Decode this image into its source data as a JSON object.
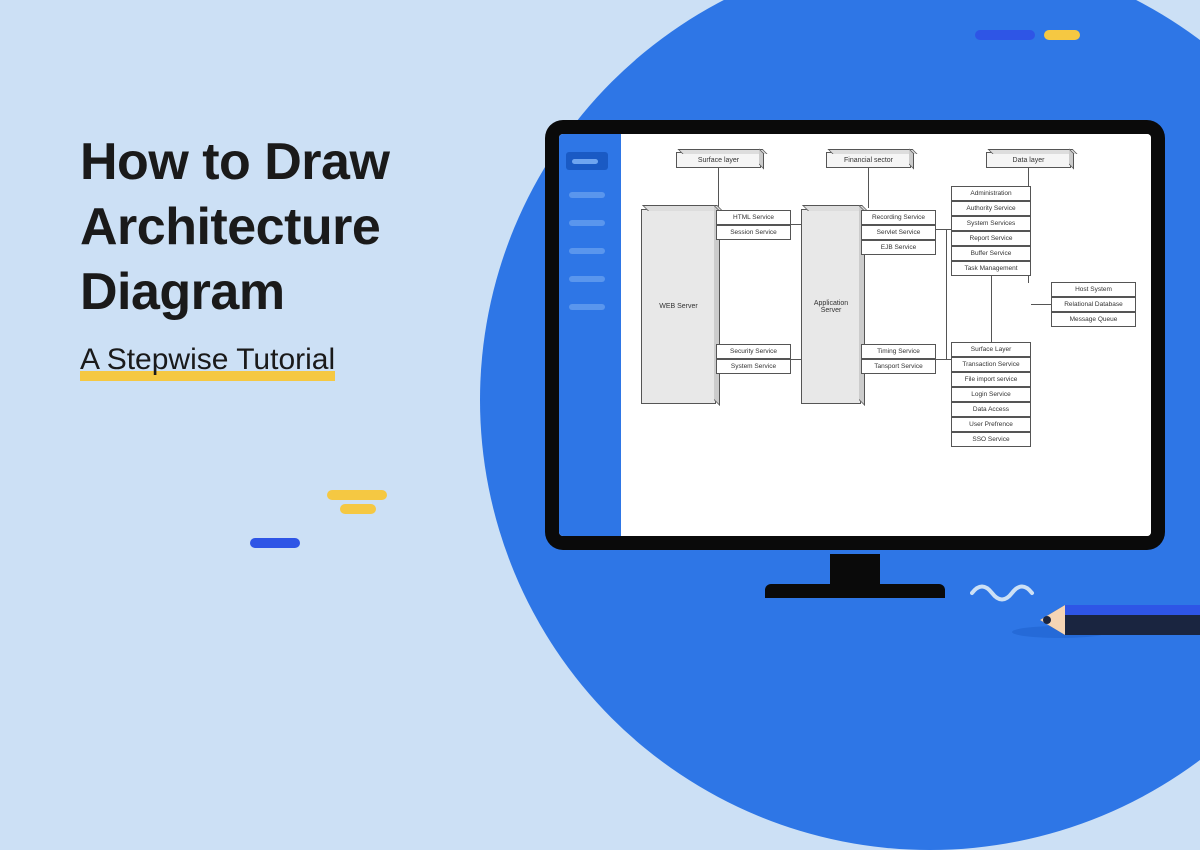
{
  "title_line1": "How to Draw",
  "title_line2": "Architecture",
  "title_line3": "Diagram",
  "subtitle": "A Stepwise Tutorial",
  "diagram": {
    "headers": [
      "Surface layer",
      "Financial sector",
      "Data layer"
    ],
    "web_server": "WEB Server",
    "app_server": "Application\nServer",
    "col1_top": [
      "HTML Service",
      "Session Service"
    ],
    "col1_bot": [
      "Security Service",
      "System Service"
    ],
    "col2_top": [
      "Recording Service",
      "Servlet Service",
      "EJB Service"
    ],
    "col2_bot": [
      "Timing Service",
      "Tansport Service"
    ],
    "col3_top": [
      "Administration",
      "Authority Service",
      "System Services",
      "Report Service",
      "Buffer Service",
      "Task Management"
    ],
    "col3_bot": [
      "Surface Layer",
      "Transaction Service",
      "File import service",
      "Login Service",
      "Data Access",
      "User Prefrence",
      "SSO Service"
    ],
    "col4": [
      "Host System",
      "Relational Database",
      "Message Queue"
    ]
  }
}
